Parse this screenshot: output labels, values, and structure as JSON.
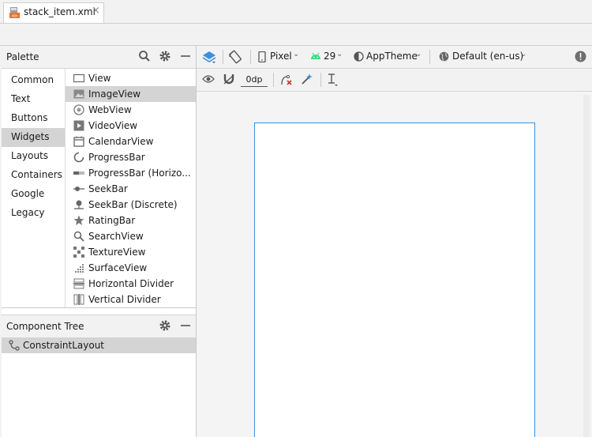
{
  "tab": {
    "filename": "stack_item.xml",
    "close": "×"
  },
  "palette": {
    "title": "Palette",
    "icons": [
      "search-icon",
      "gear-icon",
      "minimize-icon"
    ],
    "categories": [
      {
        "label": "Common"
      },
      {
        "label": "Text"
      },
      {
        "label": "Buttons"
      },
      {
        "label": "Widgets",
        "selected": true
      },
      {
        "label": "Layouts"
      },
      {
        "label": "Containers"
      },
      {
        "label": "Google"
      },
      {
        "label": "Legacy"
      }
    ],
    "items": [
      {
        "label": "View",
        "icon": "view-icon"
      },
      {
        "label": "ImageView",
        "icon": "image-icon",
        "selected": true
      },
      {
        "label": "WebView",
        "icon": "globe-icon"
      },
      {
        "label": "VideoView",
        "icon": "video-icon"
      },
      {
        "label": "CalendarView",
        "icon": "calendar-icon"
      },
      {
        "label": "ProgressBar",
        "icon": "progress-circle-icon"
      },
      {
        "label": "ProgressBar (Horizo...",
        "icon": "progress-bar-icon"
      },
      {
        "label": "SeekBar",
        "icon": "seekbar-icon"
      },
      {
        "label": "SeekBar (Discrete)",
        "icon": "seekbar-discrete-icon"
      },
      {
        "label": "RatingBar",
        "icon": "star-icon"
      },
      {
        "label": "SearchView",
        "icon": "search-icon"
      },
      {
        "label": "TextureView",
        "icon": "texture-icon"
      },
      {
        "label": "SurfaceView",
        "icon": "surface-icon"
      },
      {
        "label": "Horizontal Divider",
        "icon": "horizontal-divider-icon"
      },
      {
        "label": "Vertical Divider",
        "icon": "vertical-divider-icon"
      }
    ]
  },
  "component_tree": {
    "title": "Component Tree",
    "root": {
      "label": "ConstraintLayout",
      "icon": "constraint-layout-icon"
    }
  },
  "toolbar": {
    "device": "Pixel",
    "api": "29",
    "theme": "AppTheme",
    "locale": "Default (en-us)",
    "margin": "0dp"
  },
  "colors": {
    "accent": "#3d8fde",
    "selection": "#d4d4d4",
    "android_green": "#3ddc84"
  }
}
